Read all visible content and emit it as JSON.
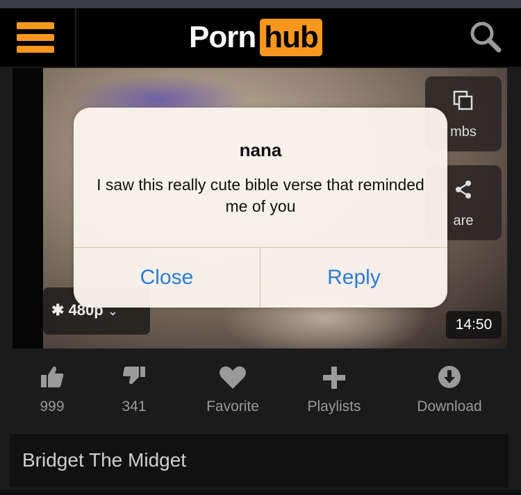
{
  "header": {
    "logo_part1": "Porn",
    "logo_part2": "hub",
    "accent_color": "#f7971d"
  },
  "icons": {
    "menu": "hamburger-icon",
    "search": "search-icon",
    "thumbs": "thumbnails-icon",
    "share": "share-icon",
    "quality": "gear-icon",
    "chevron": "chevron-down-icon",
    "like": "thumbs-up-icon",
    "dislike": "thumbs-down-icon",
    "favorite": "heart-icon",
    "playlists": "plus-icon",
    "download": "download-icon"
  },
  "player": {
    "thumbs_label": "mbs",
    "share_label": "are",
    "quality_label": "480p",
    "duration": "14:50"
  },
  "alert": {
    "title": "nana",
    "message": "I saw this really cute bible verse that reminded me of you",
    "close_label": "Close",
    "reply_label": "Reply",
    "button_color": "#2d7bd6"
  },
  "actions": {
    "likes": "999",
    "dislikes": "341",
    "favorite": "Favorite",
    "playlists": "Playlists",
    "download": "Download"
  },
  "video_title": "Bridget The Midget"
}
